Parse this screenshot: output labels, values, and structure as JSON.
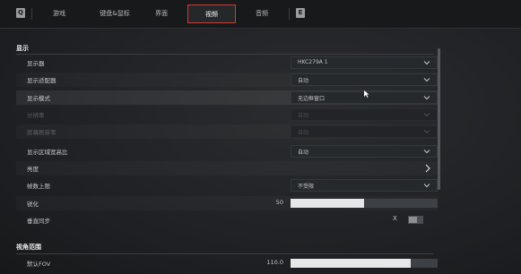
{
  "tabbar": {
    "left_key": "Q",
    "right_key": "E",
    "tabs": [
      {
        "label": "游戏"
      },
      {
        "label": "键盘&鼠标"
      },
      {
        "label": "界面"
      },
      {
        "label": "视频"
      },
      {
        "label": "音频"
      }
    ],
    "active_tab": "视频"
  },
  "display": {
    "title": "显示",
    "rows": [
      {
        "label": "显示器",
        "value": "HKC279A 1",
        "control": "dropdown",
        "enabled": true
      },
      {
        "label": "显示适配器",
        "value": "自动",
        "control": "dropdown",
        "enabled": true
      },
      {
        "label": "显示模式",
        "value": "无边框窗口",
        "control": "dropdown",
        "enabled": true
      },
      {
        "label": "分辨率",
        "value": "自动",
        "control": "dropdown",
        "enabled": false
      },
      {
        "label": "屏幕刷新率",
        "value": "自动",
        "control": "dropdown",
        "enabled": false
      },
      {
        "label": "显示区域宽高比",
        "value": "自动",
        "control": "dropdown",
        "enabled": true
      },
      {
        "label": "亮度",
        "value": "",
        "control": "arrow",
        "enabled": true
      },
      {
        "label": "帧数上限",
        "value": "不受限",
        "control": "dropdown",
        "enabled": true
      },
      {
        "label": "锐化",
        "value": "50",
        "control": "slider",
        "fill": 0.5,
        "enabled": true
      },
      {
        "label": "垂直同步",
        "value": "X",
        "control": "toggle",
        "on": false,
        "enabled": true
      }
    ]
  },
  "fov": {
    "title": "视角范围",
    "rows": [
      {
        "label": "默认FOV",
        "value": "110.0",
        "control": "slider",
        "fill": 0.82,
        "enabled": true
      }
    ]
  },
  "colors": {
    "accent_red": "#d9382f",
    "slider_fill": "#e6e7e8"
  }
}
